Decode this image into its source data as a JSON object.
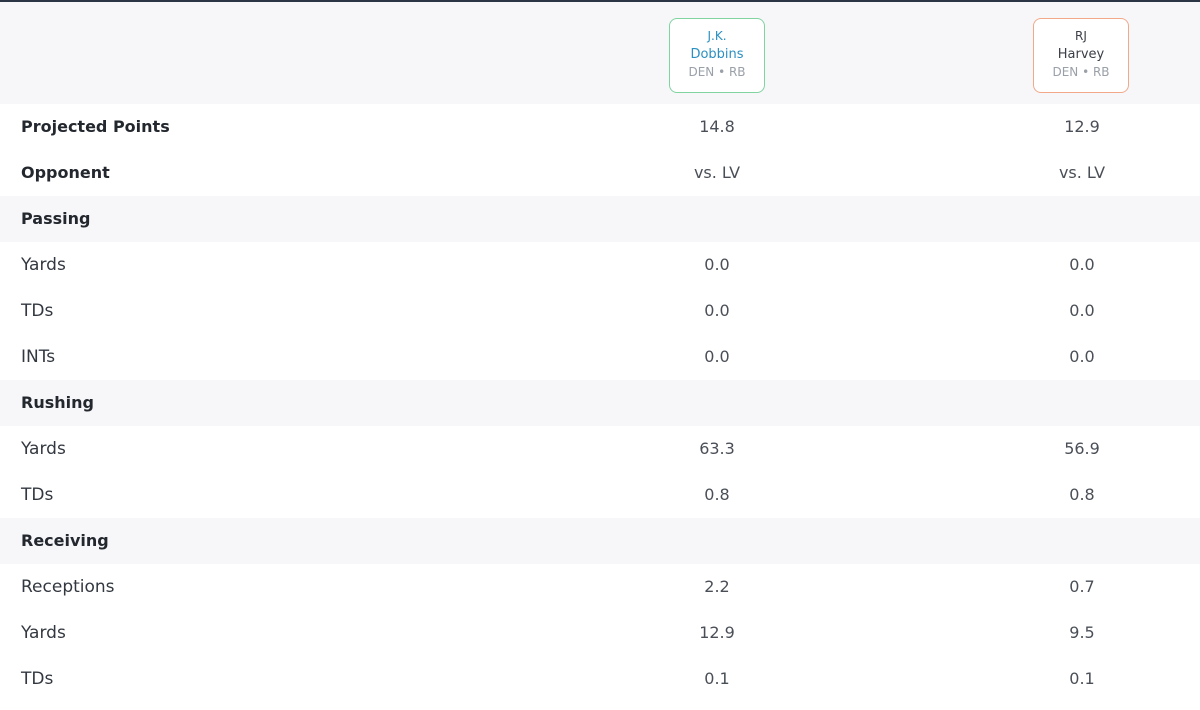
{
  "players": [
    {
      "first": "J.K.",
      "last": "Dobbins",
      "meta": "DEN • RB",
      "accent": "#7fd4a0"
    },
    {
      "first": "RJ",
      "last": "Harvey",
      "meta": "DEN • RB",
      "accent": "#f2a98a"
    }
  ],
  "rows": [
    {
      "label": "Projected Points",
      "v1": "14.8",
      "v2": "12.9"
    },
    {
      "label": "Opponent",
      "v1": "vs. LV",
      "v2": "vs. LV"
    },
    {
      "label": "Passing",
      "v1": "",
      "v2": ""
    },
    {
      "label": "Yards",
      "v1": "0.0",
      "v2": "0.0"
    },
    {
      "label": "TDs",
      "v1": "0.0",
      "v2": "0.0"
    },
    {
      "label": "INTs",
      "v1": "0.0",
      "v2": "0.0"
    },
    {
      "label": "Rushing",
      "v1": "",
      "v2": ""
    },
    {
      "label": "Yards",
      "v1": "63.3",
      "v2": "56.9"
    },
    {
      "label": "TDs",
      "v1": "0.8",
      "v2": "0.8"
    },
    {
      "label": "Receiving",
      "v1": "",
      "v2": ""
    },
    {
      "label": "Receptions",
      "v1": "2.2",
      "v2": "0.7"
    },
    {
      "label": "Yards",
      "v1": "12.9",
      "v2": "9.5"
    },
    {
      "label": "TDs",
      "v1": "0.1",
      "v2": "0.1"
    }
  ]
}
